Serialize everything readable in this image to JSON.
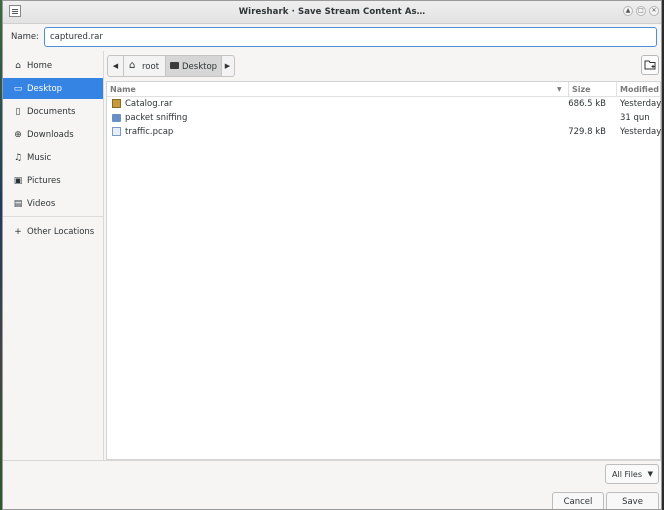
{
  "window": {
    "title": "Wireshark · Save Stream Content As…",
    "controls": [
      "minimize",
      "maximize",
      "close"
    ]
  },
  "name_field": {
    "label": "Name:",
    "value": "captured.rar"
  },
  "sidebar": {
    "items": [
      {
        "label": "Home",
        "icon": "home-icon"
      },
      {
        "label": "Desktop",
        "icon": "desktop-icon",
        "active": true
      },
      {
        "label": "Documents",
        "icon": "document-icon"
      },
      {
        "label": "Downloads",
        "icon": "download-icon"
      },
      {
        "label": "Music",
        "icon": "music-icon"
      },
      {
        "label": "Pictures",
        "icon": "picture-icon"
      },
      {
        "label": "Videos",
        "icon": "video-icon"
      },
      {
        "label": "Other Locations",
        "icon": "plus-icon"
      }
    ]
  },
  "pathbar": {
    "segments": [
      "root",
      "Desktop"
    ]
  },
  "filelist": {
    "columns": {
      "name": "Name",
      "size": "Size",
      "modified": "Modified"
    },
    "rows": [
      {
        "name": "Catalog.rar",
        "size": "686.5 kB",
        "modified": "Yesterday",
        "icon": "archive-icon"
      },
      {
        "name": "packet sniffing",
        "size": "",
        "modified": "31 qun",
        "icon": "folder-icon"
      },
      {
        "name": "traffic.pcap",
        "size": "729.8 kB",
        "modified": "Yesterday",
        "icon": "pcap-file-icon"
      }
    ]
  },
  "filter": {
    "selected": "All Files"
  },
  "buttons": {
    "cancel": "Cancel",
    "save": "Save"
  },
  "colors": {
    "accent": "#3584e4",
    "focus_border": "#4a90d9"
  }
}
